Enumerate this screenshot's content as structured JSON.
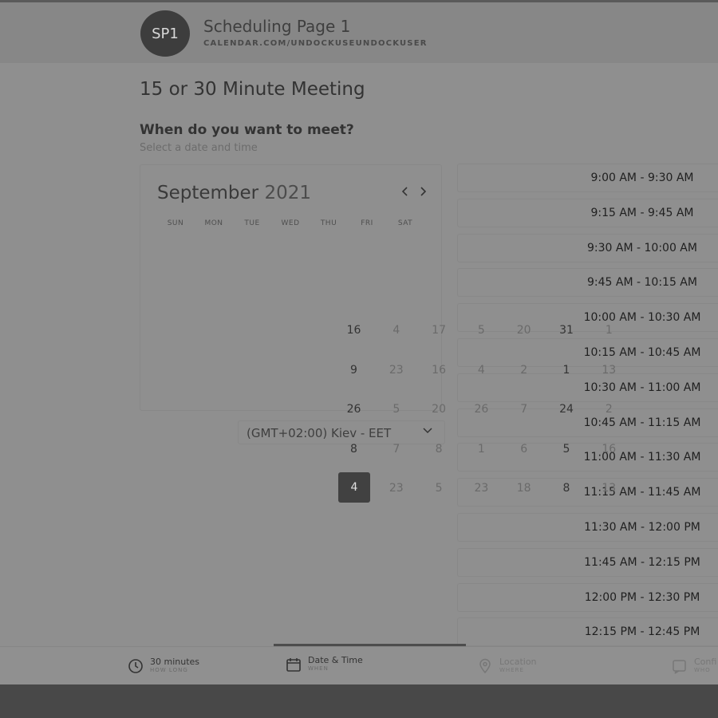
{
  "header": {
    "avatar_initials": "SP1",
    "title": "Scheduling Page 1",
    "url": "CALENDAR.COM/UNDOCKUSEUNDOCKUSER"
  },
  "meeting": {
    "title": "15 or 30 Minute Meeting",
    "question": "When do you want to meet?",
    "subtitle": "Select a date and time"
  },
  "calendar": {
    "month": "September",
    "year": "2021",
    "prev_icon": "chevron-left-icon",
    "next_icon": "chevron-right-icon",
    "weekdays": [
      "SUN",
      "MON",
      "TUE",
      "WED",
      "THU",
      "FRI",
      "SAT"
    ]
  },
  "timezone": {
    "value": "(GMT+02:00) Kiev - EET"
  },
  "slots": [
    "9:00 AM - 9:30 AM",
    "9:15 AM - 9:45 AM",
    "9:30 AM - 10:00 AM",
    "9:45 AM - 10:15 AM",
    "10:00 AM - 10:30 AM",
    "10:15 AM - 10:45 AM",
    "10:30 AM - 11:00 AM",
    "10:45 AM - 11:15 AM",
    "11:00 AM - 11:30 AM",
    "11:15 AM - 11:45 AM",
    "11:30 AM - 12:00 PM",
    "11:45 AM - 12:15 PM",
    "12:00 PM - 12:30 PM",
    "12:15 PM - 12:45 PM"
  ],
  "overlay_days": [
    [
      "16",
      "4",
      "17",
      "5",
      "20",
      "31",
      "1"
    ],
    [
      "9",
      "23",
      "16",
      "4",
      "2",
      "1",
      "13"
    ],
    [
      "26",
      "5",
      "20",
      "26",
      "7",
      "24",
      "2"
    ],
    [
      "8",
      "7",
      "8",
      "1",
      "6",
      "5",
      "16"
    ],
    [
      "4",
      "23",
      "5",
      "23",
      "18",
      "8",
      "13"
    ]
  ],
  "selected_day": "4",
  "tabs": {
    "duration": {
      "label": "30 minutes",
      "sub": "HOW LONG",
      "icon": "clock-icon"
    },
    "datetime": {
      "label": "Date & Time",
      "sub": "WHEN",
      "icon": "calendar-icon"
    },
    "location": {
      "label": "Location",
      "sub": "WHERE",
      "icon": "location-pin-icon"
    },
    "confirm": {
      "label": "Confi",
      "sub": "WHO",
      "icon": "confirm-icon"
    }
  },
  "colors": {
    "overlay_bg": "#8f8f8f",
    "selected_day_bg": "#414141",
    "avatar_bg": "#3d3d3d"
  }
}
